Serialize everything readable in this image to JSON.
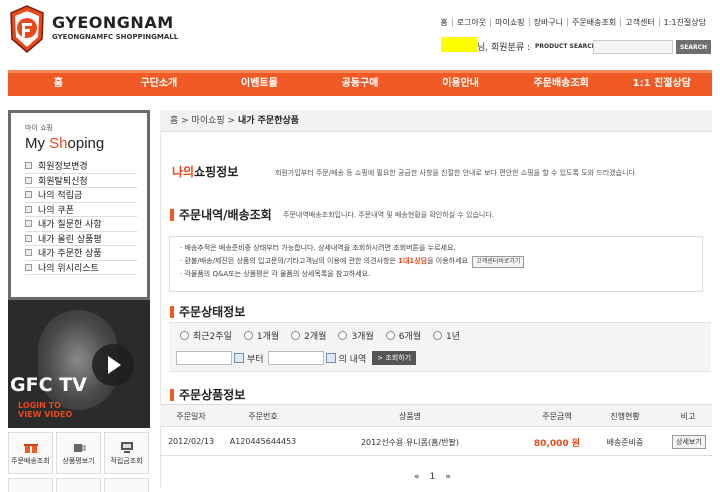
{
  "header": {
    "brand_title": "GYEONGNAM",
    "brand_subtitle": "GYEONGNAMFC SHOPPINGMALL",
    "top_links": [
      "홈",
      "로그아웃",
      "마이쇼핑",
      "장바구니",
      "주문배송조회",
      "고객센터",
      "1:1친절상담"
    ],
    "member_grade": "님, 회원분류 :",
    "product_search_label": "PRODUCT SEARCH",
    "search_value": "",
    "search_button": "SEARCH"
  },
  "nav": [
    "홈",
    "구단소개",
    "이벤트몰",
    "공동구매",
    "이용안내",
    "주문배송조회",
    "1:1 친절상담"
  ],
  "sidebar": {
    "small_title": "마이 쇼핑",
    "big_title_prefix": "My ",
    "big_title_highlight": "Sh",
    "big_title_suffix": "oping",
    "menu": [
      "회원정보변경",
      "회원탈퇴신청",
      "나의 적립금",
      "나의 쿠폰",
      "내가 질문한 사항",
      "내가 올린 상품평",
      "내가 주문한 상품",
      "나의 위시리스트"
    ],
    "tv_title": "GFC TV",
    "tv_sub1": "LOGIN TO",
    "tv_sub2": "VIEW VIDEO",
    "quick": [
      "주문배송조회",
      "상품평보기",
      "적립금조회"
    ]
  },
  "breadcrumb": {
    "home": "홈",
    "sep1": " > 마이쇼핑 > ",
    "current": "내가 주문한상품"
  },
  "myinfo": {
    "title_hl": "나의",
    "title_rest": "쇼핑정보",
    "desc": "회원가입부터 주문/배송 등 쇼핑에 필요한 궁금한 사항을 친절한 안내로 보다 편안한 쇼핑을 할 수 있도록 도와 드리겠습니다."
  },
  "order_lookup": {
    "title": "주문내역/배송조회",
    "desc": "주문내역배송조회입니다. 주문내역 및 배송현황을 확인하실 수 있습니다.",
    "notice1": "배송추적은 배송준비중 상태부터 가능합니다. 상세내역을 조회하시려면 조회버튼을 누르세요.",
    "notice2a": "환불/배송/제진된 상품의 입고문의/기타고객님의 이용에 관한 의견사항은 ",
    "notice2_red": "1대1상담",
    "notice2b": "을 이용하세요",
    "notice2_button": "고객센터바로가기",
    "notice3": "각물품의 Q&A또는 상품평은 각 물품의 상세목록을 참고하세요."
  },
  "order_status": {
    "title": "주문상태정보",
    "periods": [
      "최근2주일",
      "1개월",
      "2개월",
      "3개월",
      "6개월",
      "1년"
    ],
    "from_label": "부터",
    "to_label": "의 내역",
    "query_button": "조회하기"
  },
  "order_products": {
    "title": "주문상품정보",
    "columns": [
      "주문일자",
      "주문번호",
      "상품명",
      "주문금액",
      "진행현황",
      "비고"
    ],
    "rows": [
      {
        "date": "2012/02/13",
        "number": "A120445644453",
        "product": "2012선수용 유니폼(홈/반팔)",
        "amount": "80,000 원",
        "status": "배송준비중",
        "action": "상세보기"
      }
    ],
    "pager_prev": "«",
    "pager_page": "1",
    "pager_next": "»"
  },
  "colors": {
    "accent": "#f15a24",
    "highlight": "#e8481c"
  }
}
